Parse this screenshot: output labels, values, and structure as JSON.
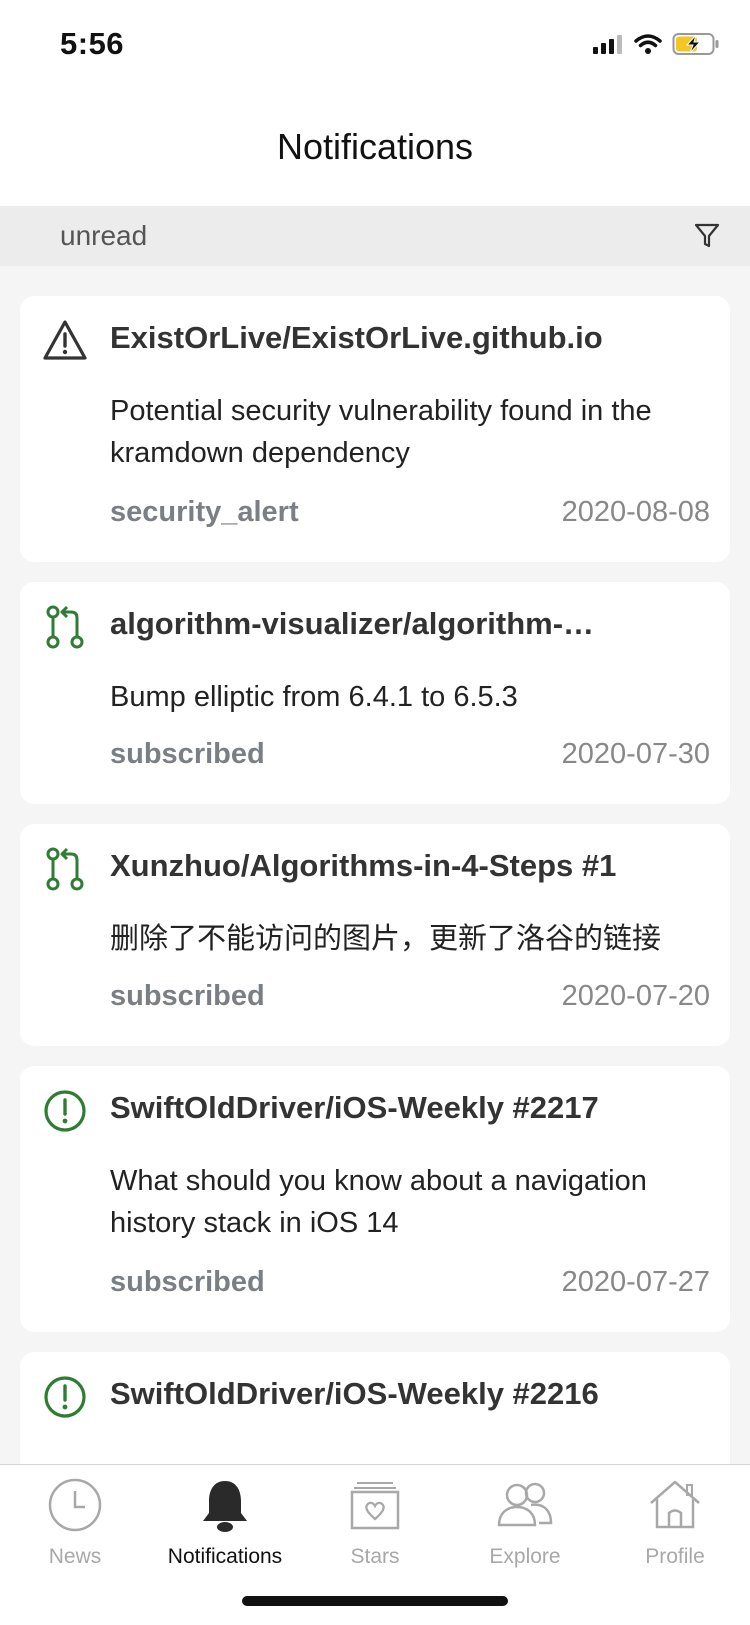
{
  "status_bar": {
    "time": "5:56"
  },
  "nav": {
    "title": "Notifications"
  },
  "filter": {
    "label": "unread",
    "icon": "filter-icon"
  },
  "colors": {
    "accent_green": "#2f7d32",
    "secondary_text": "#7a7f85"
  },
  "notifications": [
    {
      "icon": "alert-triangle-icon",
      "title": "ExistOrLive/ExistOrLive.github.io",
      "body": "Potential security vulnerability found in the kramdown dependency",
      "reason": "security_alert",
      "date": "2020-08-08"
    },
    {
      "icon": "pull-request-icon",
      "title": "algorithm-visualizer/algorithm-…",
      "body": "Bump elliptic from 6.4.1 to 6.5.3",
      "reason": "subscribed",
      "date": "2020-07-30"
    },
    {
      "icon": "pull-request-icon",
      "title": "Xunzhuo/Algorithms-in-4-Steps #1",
      "body": "删除了不能访问的图片，更新了洛谷的链接",
      "reason": "subscribed",
      "date": "2020-07-20"
    },
    {
      "icon": "issue-opened-icon",
      "title": "SwiftOldDriver/iOS-Weekly #2217",
      "body": "What should you know about a navigation history stack in iOS 14",
      "reason": "subscribed",
      "date": "2020-07-27"
    },
    {
      "icon": "issue-opened-icon",
      "title": "SwiftOldDriver/iOS-Weekly #2216",
      "body": "",
      "reason": "",
      "date": ""
    }
  ],
  "tabs": [
    {
      "label": "News",
      "icon": "clock-icon",
      "active": false
    },
    {
      "label": "Notifications",
      "icon": "bell-icon",
      "active": true
    },
    {
      "label": "Stars",
      "icon": "heart-box-icon",
      "active": false
    },
    {
      "label": "Explore",
      "icon": "people-icon",
      "active": false
    },
    {
      "label": "Profile",
      "icon": "house-icon",
      "active": false
    }
  ]
}
